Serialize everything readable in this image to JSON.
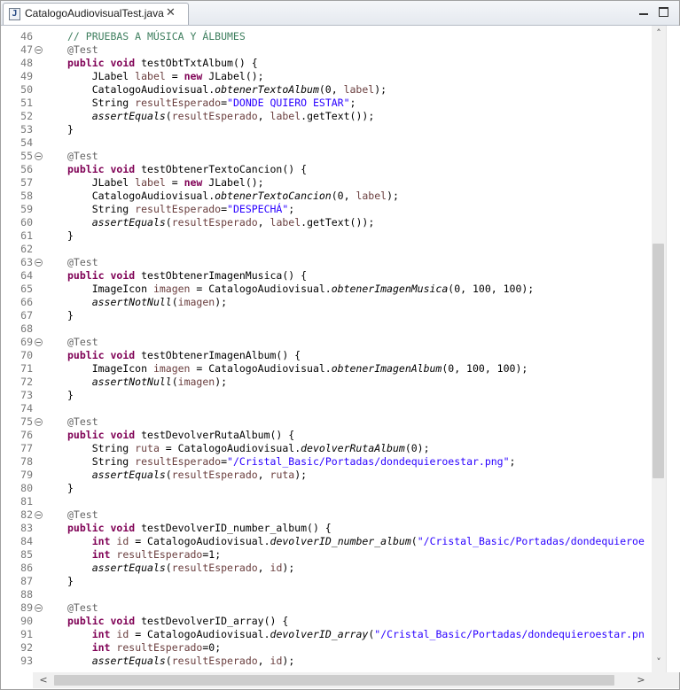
{
  "tab": {
    "title": "CatalogoAudiovisualTest.java",
    "icon": "java-file-icon",
    "close_glyph": "✕"
  },
  "window": {
    "minimize": "minimize-icon",
    "maximize": "maximize-icon"
  },
  "scroll": {
    "up": "˄",
    "down": "˅",
    "left": "<",
    "right": ">"
  },
  "lines": [
    {
      "n": "46",
      "tokens": [
        [
          "cm",
          "// PRUEBAS A MÚSICA Y ÁLBUMES"
        ]
      ]
    },
    {
      "n": "47",
      "fold": true,
      "tokens": [
        [
          "an",
          "@Test"
        ]
      ]
    },
    {
      "n": "48",
      "tokens": [
        [
          "kw",
          "public"
        ],
        [
          "",
          ""
        ],
        [
          "kw",
          " void"
        ],
        [
          "",
          " testObtTxtAlbum() {"
        ]
      ]
    },
    {
      "n": "49",
      "tokens": [
        [
          "",
          "    JLabel "
        ],
        [
          "fld",
          "label"
        ],
        [
          "",
          " = "
        ],
        [
          "kw",
          "new"
        ],
        [
          "",
          " JLabel();"
        ]
      ]
    },
    {
      "n": "50",
      "tokens": [
        [
          "",
          "    CatalogoAudiovisual."
        ],
        [
          "it",
          "obtenerTextoAlbum"
        ],
        [
          "",
          "(0, "
        ],
        [
          "fld",
          "label"
        ],
        [
          "",
          ");"
        ]
      ]
    },
    {
      "n": "51",
      "tokens": [
        [
          "",
          "    String "
        ],
        [
          "fld",
          "resultEsperado"
        ],
        [
          "",
          "="
        ],
        [
          "st",
          "\"DONDE QUIERO ESTAR\""
        ],
        [
          "",
          ";"
        ]
      ]
    },
    {
      "n": "52",
      "tokens": [
        [
          "",
          "    "
        ],
        [
          "it",
          "assertEquals"
        ],
        [
          "",
          "("
        ],
        [
          "fld",
          "resultEsperado"
        ],
        [
          "",
          ", "
        ],
        [
          "fld",
          "label"
        ],
        [
          "",
          ".getText());"
        ]
      ]
    },
    {
      "n": "53",
      "tokens": [
        [
          "",
          "}"
        ]
      ]
    },
    {
      "n": "54",
      "tokens": []
    },
    {
      "n": "55",
      "fold": true,
      "tokens": [
        [
          "an",
          "@Test"
        ]
      ]
    },
    {
      "n": "56",
      "tokens": [
        [
          "kw",
          "public"
        ],
        [
          "kw",
          " void"
        ],
        [
          "",
          " testObtenerTextoCancion() {"
        ]
      ]
    },
    {
      "n": "57",
      "tokens": [
        [
          "",
          "    JLabel "
        ],
        [
          "fld",
          "label"
        ],
        [
          "",
          " = "
        ],
        [
          "kw",
          "new"
        ],
        [
          "",
          " JLabel();"
        ]
      ]
    },
    {
      "n": "58",
      "tokens": [
        [
          "",
          "    CatalogoAudiovisual."
        ],
        [
          "it",
          "obtenerTextoCancion"
        ],
        [
          "",
          "(0, "
        ],
        [
          "fld",
          "label"
        ],
        [
          "",
          ");"
        ]
      ]
    },
    {
      "n": "59",
      "tokens": [
        [
          "",
          "    String "
        ],
        [
          "fld",
          "resultEsperado"
        ],
        [
          "",
          "="
        ],
        [
          "st",
          "\"DESPECHÁ\""
        ],
        [
          "",
          ";"
        ]
      ]
    },
    {
      "n": "60",
      "tokens": [
        [
          "",
          "    "
        ],
        [
          "it",
          "assertEquals"
        ],
        [
          "",
          "("
        ],
        [
          "fld",
          "resultEsperado"
        ],
        [
          "",
          ", "
        ],
        [
          "fld",
          "label"
        ],
        [
          "",
          ".getText());"
        ]
      ]
    },
    {
      "n": "61",
      "tokens": [
        [
          "",
          "}"
        ]
      ]
    },
    {
      "n": "62",
      "tokens": []
    },
    {
      "n": "63",
      "fold": true,
      "tokens": [
        [
          "an",
          "@Test"
        ]
      ]
    },
    {
      "n": "64",
      "tokens": [
        [
          "kw",
          "public"
        ],
        [
          "kw",
          " void"
        ],
        [
          "",
          " testObtenerImagenMusica() {"
        ]
      ]
    },
    {
      "n": "65",
      "tokens": [
        [
          "",
          "    ImageIcon "
        ],
        [
          "fld",
          "imagen"
        ],
        [
          "",
          " = CatalogoAudiovisual."
        ],
        [
          "it",
          "obtenerImagenMusica"
        ],
        [
          "",
          "(0, 100, 100);"
        ]
      ]
    },
    {
      "n": "66",
      "tokens": [
        [
          "",
          "    "
        ],
        [
          "it",
          "assertNotNull"
        ],
        [
          "",
          "("
        ],
        [
          "fld",
          "imagen"
        ],
        [
          "",
          ");"
        ]
      ]
    },
    {
      "n": "67",
      "tokens": [
        [
          "",
          "}"
        ]
      ]
    },
    {
      "n": "68",
      "tokens": []
    },
    {
      "n": "69",
      "fold": true,
      "tokens": [
        [
          "an",
          "@Test"
        ]
      ]
    },
    {
      "n": "70",
      "tokens": [
        [
          "kw",
          "public"
        ],
        [
          "kw",
          " void"
        ],
        [
          "",
          " testObtenerImagenAlbum() {"
        ]
      ]
    },
    {
      "n": "71",
      "tokens": [
        [
          "",
          "    ImageIcon "
        ],
        [
          "fld",
          "imagen"
        ],
        [
          "",
          " = CatalogoAudiovisual."
        ],
        [
          "it",
          "obtenerImagenAlbum"
        ],
        [
          "",
          "(0, 100, 100);"
        ]
      ]
    },
    {
      "n": "72",
      "tokens": [
        [
          "",
          "    "
        ],
        [
          "it",
          "assertNotNull"
        ],
        [
          "",
          "("
        ],
        [
          "fld",
          "imagen"
        ],
        [
          "",
          ");"
        ]
      ]
    },
    {
      "n": "73",
      "tokens": [
        [
          "",
          "}"
        ]
      ]
    },
    {
      "n": "74",
      "tokens": []
    },
    {
      "n": "75",
      "fold": true,
      "tokens": [
        [
          "an",
          "@Test"
        ]
      ]
    },
    {
      "n": "76",
      "tokens": [
        [
          "kw",
          "public"
        ],
        [
          "kw",
          " void"
        ],
        [
          "",
          " testDevolverRutaAlbum() {"
        ]
      ]
    },
    {
      "n": "77",
      "tokens": [
        [
          "",
          "    String "
        ],
        [
          "fld",
          "ruta"
        ],
        [
          "",
          " = CatalogoAudiovisual."
        ],
        [
          "it",
          "devolverRutaAlbum"
        ],
        [
          "",
          "(0);"
        ]
      ]
    },
    {
      "n": "78",
      "tokens": [
        [
          "",
          "    String "
        ],
        [
          "fld",
          "resultEsperado"
        ],
        [
          "",
          "="
        ],
        [
          "st",
          "\"/Cristal_Basic/Portadas/dondequieroestar.png\""
        ],
        [
          "",
          ";"
        ]
      ]
    },
    {
      "n": "79",
      "tokens": [
        [
          "",
          "    "
        ],
        [
          "it",
          "assertEquals"
        ],
        [
          "",
          "("
        ],
        [
          "fld",
          "resultEsperado"
        ],
        [
          "",
          ", "
        ],
        [
          "fld",
          "ruta"
        ],
        [
          "",
          ");"
        ]
      ]
    },
    {
      "n": "80",
      "tokens": [
        [
          "",
          "}"
        ]
      ]
    },
    {
      "n": "81",
      "tokens": []
    },
    {
      "n": "82",
      "fold": true,
      "tokens": [
        [
          "an",
          "@Test"
        ]
      ]
    },
    {
      "n": "83",
      "tokens": [
        [
          "kw",
          "public"
        ],
        [
          "kw",
          " void"
        ],
        [
          "",
          " testDevolverID_number_album() {"
        ]
      ]
    },
    {
      "n": "84",
      "tokens": [
        [
          "",
          "    "
        ],
        [
          "kw",
          "int"
        ],
        [
          "",
          " "
        ],
        [
          "fld",
          "id"
        ],
        [
          "",
          " = CatalogoAudiovisual."
        ],
        [
          "it",
          "devolverID_number_album"
        ],
        [
          "",
          "("
        ],
        [
          "st",
          "\"/Cristal_Basic/Portadas/dondequieroe"
        ]
      ]
    },
    {
      "n": "85",
      "tokens": [
        [
          "",
          "    "
        ],
        [
          "kw",
          "int"
        ],
        [
          "",
          " "
        ],
        [
          "fld",
          "resultEsperado"
        ],
        [
          "",
          "=1;"
        ]
      ]
    },
    {
      "n": "86",
      "tokens": [
        [
          "",
          "    "
        ],
        [
          "it",
          "assertEquals"
        ],
        [
          "",
          "("
        ],
        [
          "fld",
          "resultEsperado"
        ],
        [
          "",
          ", "
        ],
        [
          "fld",
          "id"
        ],
        [
          "",
          ");"
        ]
      ]
    },
    {
      "n": "87",
      "tokens": [
        [
          "",
          "}"
        ]
      ]
    },
    {
      "n": "88",
      "tokens": []
    },
    {
      "n": "89",
      "fold": true,
      "tokens": [
        [
          "an",
          "@Test"
        ]
      ]
    },
    {
      "n": "90",
      "tokens": [
        [
          "kw",
          "public"
        ],
        [
          "kw",
          " void"
        ],
        [
          "",
          " testDevolverID_array() {"
        ]
      ]
    },
    {
      "n": "91",
      "tokens": [
        [
          "",
          "    "
        ],
        [
          "kw",
          "int"
        ],
        [
          "",
          " "
        ],
        [
          "fld",
          "id"
        ],
        [
          "",
          " = CatalogoAudiovisual."
        ],
        [
          "it",
          "devolverID_array"
        ],
        [
          "",
          "("
        ],
        [
          "st",
          "\"/Cristal_Basic/Portadas/dondequieroestar.pn"
        ]
      ]
    },
    {
      "n": "92",
      "tokens": [
        [
          "",
          "    "
        ],
        [
          "kw",
          "int"
        ],
        [
          "",
          " "
        ],
        [
          "fld",
          "resultEsperado"
        ],
        [
          "",
          "=0;"
        ]
      ]
    },
    {
      "n": "93",
      "tokens": [
        [
          "",
          "    "
        ],
        [
          "it",
          "assertEquals"
        ],
        [
          "",
          "("
        ],
        [
          "fld",
          "resultEsperado"
        ],
        [
          "",
          ", "
        ],
        [
          "fld",
          "id"
        ],
        [
          "",
          ");"
        ]
      ]
    }
  ]
}
